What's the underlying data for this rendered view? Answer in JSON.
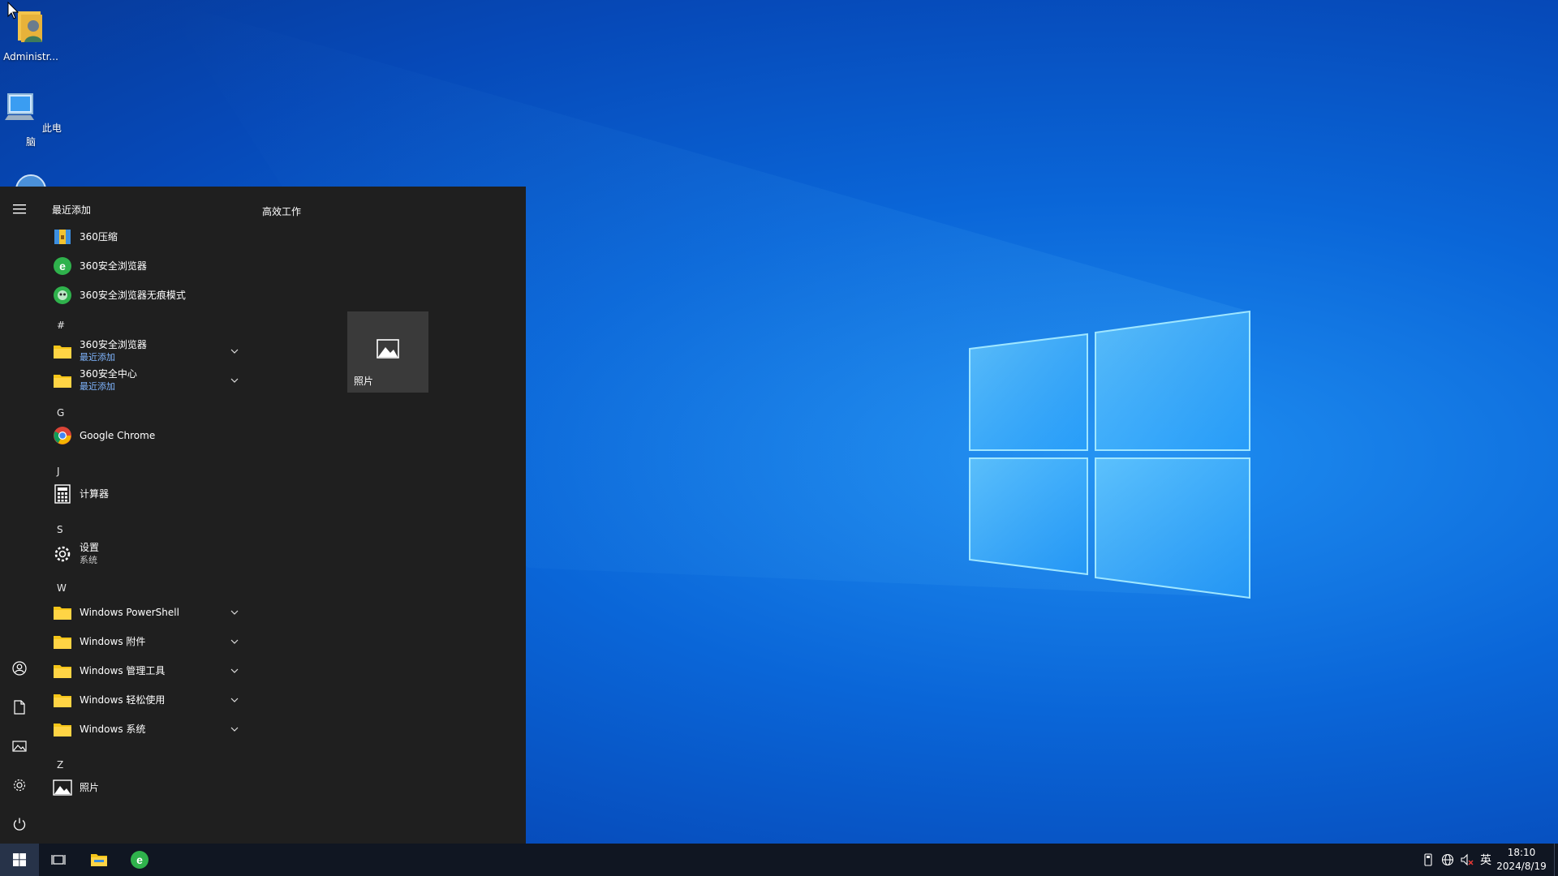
{
  "desktop": {
    "icons": [
      {
        "label": "Administr..."
      },
      {
        "label": "此电脑"
      }
    ]
  },
  "start_menu": {
    "recent_header": "最近添加",
    "recent_apps": [
      {
        "label": "360压缩"
      },
      {
        "label": "360安全浏览器"
      },
      {
        "label": "360安全浏览器无痕模式"
      }
    ],
    "letters": {
      "hash": "#",
      "g": "G",
      "j": "J",
      "s": "S",
      "w": "W",
      "z": "Z"
    },
    "folders_hash": [
      {
        "label": "360安全浏览器",
        "sub": "最近添加"
      },
      {
        "label": "360安全中心",
        "sub": "最近添加"
      }
    ],
    "chrome": {
      "label": "Google Chrome"
    },
    "calculator": {
      "label": "计算器"
    },
    "settings": {
      "label": "设置",
      "sub": "系统"
    },
    "windows_folders": [
      {
        "label": "Windows PowerShell"
      },
      {
        "label": "Windows 附件"
      },
      {
        "label": "Windows 管理工具"
      },
      {
        "label": "Windows 轻松使用"
      },
      {
        "label": "Windows 系统"
      }
    ],
    "photos": {
      "label": "照片"
    },
    "tiles_group_title": "高效工作",
    "tile_photos": {
      "label": "照片"
    }
  },
  "taskbar": {
    "ime": "英",
    "time": "18:10",
    "date": "2024/8/19"
  },
  "colors": {
    "start_bg": "#1f1f1f",
    "taskbar_bg": "#101622",
    "accent_sub": "#7fb5ff",
    "folder_yellow": "#f5c518"
  }
}
